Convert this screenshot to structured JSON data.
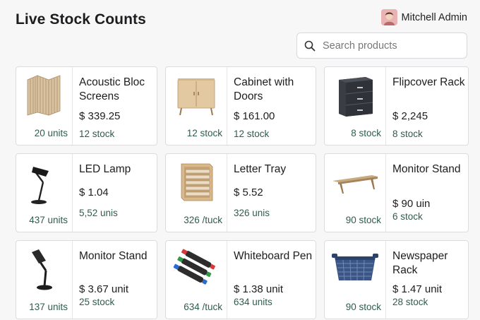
{
  "header": {
    "title": "Live Stock Counts",
    "user_name": "Mitchell Admin"
  },
  "search": {
    "placeholder": "Search products"
  },
  "products": [
    {
      "name": "Acoustic Bloc Screens",
      "price": "$ 339.25",
      "stock": "12 stock",
      "units": "20 units",
      "icon": "acoustic-screen-icon"
    },
    {
      "name": "Cabinet with Doors",
      "price": "$ 161.00",
      "stock": "12 stock",
      "units": "12 stock",
      "icon": "cabinet-icon"
    },
    {
      "name": "Flipcover Rack",
      "price": "$ 2,245",
      "stock": "8 stock",
      "units": "8 stock",
      "icon": "drawer-rack-icon"
    },
    {
      "name": "LED Lamp",
      "price": "$ 1.04",
      "stock": "5,52 unis",
      "units": "437  units",
      "icon": "desk-lamp-icon"
    },
    {
      "name": "Letter Tray",
      "price": "$ 5.52",
      "stock": "326 unis",
      "units": "326 /tuck",
      "icon": "letter-tray-icon"
    },
    {
      "name": "Monitor Stand",
      "price": "$ 90 uin",
      "stock": "6 stock",
      "units": "90 stock",
      "icon": "monitor-stand-icon"
    },
    {
      "name": "Monitor Stand",
      "price": "$ 3.67 unit",
      "stock": "25 stock",
      "units": "137  units",
      "icon": "monitor-arm-icon"
    },
    {
      "name": "Whiteboard Pen",
      "price": "$ 1.38 unit",
      "stock": "634 units",
      "units": "634 /tuck",
      "icon": "markers-icon"
    },
    {
      "name": "Newspaper Rack",
      "price": "$ 1.47 unit",
      "stock": "28 stock",
      "units": "90 stock",
      "icon": "basket-icon"
    }
  ],
  "colors": {
    "accent_green": "#2e5d4b",
    "background": "#f7f7f8"
  }
}
